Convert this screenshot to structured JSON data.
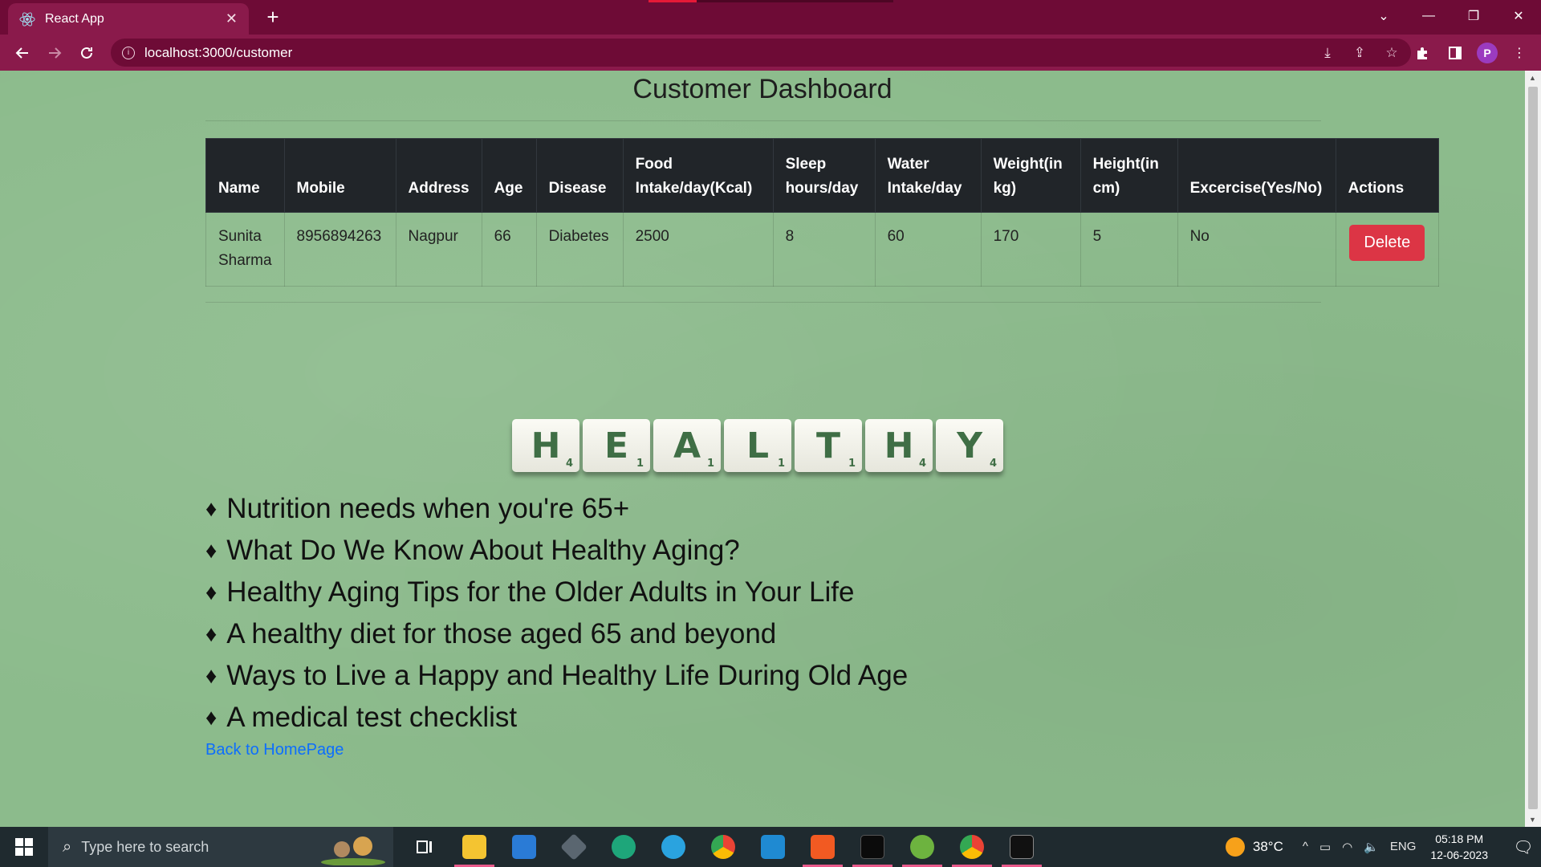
{
  "browser": {
    "tab_title": "React App",
    "url": "localhost:3000/customer",
    "profile_initial": "P"
  },
  "page": {
    "title": "Customer Dashboard",
    "table": {
      "headers": [
        "Name",
        "Mobile",
        "Address",
        "Age",
        "Disease",
        "Food Intake/day(Kcal)",
        "Sleep hours/day",
        "Water Intake/day",
        "Weight(in kg)",
        "Height(in cm)",
        "Excercise(Yes/No)",
        "Actions"
      ],
      "rows": [
        {
          "name": "Sunita Sharma",
          "mobile": "8956894263",
          "address": "Nagpur",
          "age": "66",
          "disease": "Diabetes",
          "food": "2500",
          "sleep": "8",
          "water": "60",
          "weight": "170",
          "height": "5",
          "exercise": "No",
          "action_label": "Delete"
        }
      ]
    },
    "banner_tiles": [
      {
        "letter": "H",
        "points": "4"
      },
      {
        "letter": "E",
        "points": "1"
      },
      {
        "letter": "A",
        "points": "1"
      },
      {
        "letter": "L",
        "points": "1"
      },
      {
        "letter": "T",
        "points": "1"
      },
      {
        "letter": "H",
        "points": "4"
      },
      {
        "letter": "Y",
        "points": "4"
      }
    ],
    "bullet_symbol": "♦",
    "links": [
      "Nutrition needs when you're 65+",
      "What Do We Know About Healthy Aging?",
      "Healthy Aging Tips for the Older Adults in Your Life",
      "A healthy diet for those aged 65 and beyond",
      "Ways to Live a Happy and Healthy Life During Old Age",
      "A medical test checklist"
    ],
    "back_link": "Back to HomePage"
  },
  "taskbar": {
    "search_placeholder": "Type here to search",
    "weather": "38°C",
    "language": "ENG",
    "time": "05:18 PM",
    "date": "12-06-2023",
    "apps": [
      "task-view",
      "file-explorer",
      "mail",
      "app-cube",
      "edge",
      "telegram",
      "chrome",
      "vscode",
      "brave",
      "mysql",
      "spring",
      "chrome-profile",
      "terminal"
    ]
  },
  "colors": {
    "page_bg": "#8cbb8c",
    "browser_frame": "#6e0b36",
    "table_header": "#212529",
    "delete_button": "#dc3545",
    "link": "#0d6efd"
  }
}
